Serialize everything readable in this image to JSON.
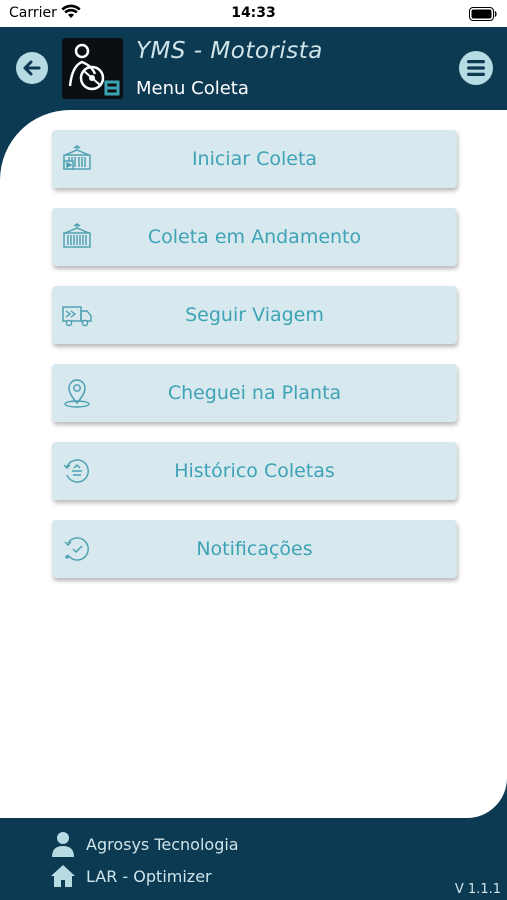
{
  "status_bar": {
    "carrier": "Carrier",
    "time": "14:33",
    "icons": [
      "wifi-icon",
      "battery-icon"
    ]
  },
  "header": {
    "title": "YMS - Motorista",
    "subtitle": "Menu Coleta",
    "back_icon": "arrow-left-icon",
    "menu_icon": "hamburger-menu-icon",
    "logo_icon": "driver-logo-icon"
  },
  "menu": {
    "items": [
      {
        "label": "Iniciar Coleta",
        "icon": "container-play-icon"
      },
      {
        "label": "Coleta em Andamento",
        "icon": "container-icon"
      },
      {
        "label": "Seguir Viagem",
        "icon": "truck-icon"
      },
      {
        "label": "Cheguei na Planta",
        "icon": "location-pin-icon"
      },
      {
        "label": "Histórico Coletas",
        "icon": "history-icon"
      },
      {
        "label": "Notificações",
        "icon": "clock-check-icon"
      }
    ]
  },
  "footer": {
    "company": "Agrosys Tecnologia",
    "product": "LAR - Optimizer",
    "version": "V 1.1.1",
    "company_icon": "user-icon",
    "product_icon": "home-icon"
  },
  "colors": {
    "primary": "#0c3a52",
    "button_bg": "#d7e8ee",
    "button_text": "#3fa3b6",
    "accent_circle": "#b7dbe3"
  }
}
